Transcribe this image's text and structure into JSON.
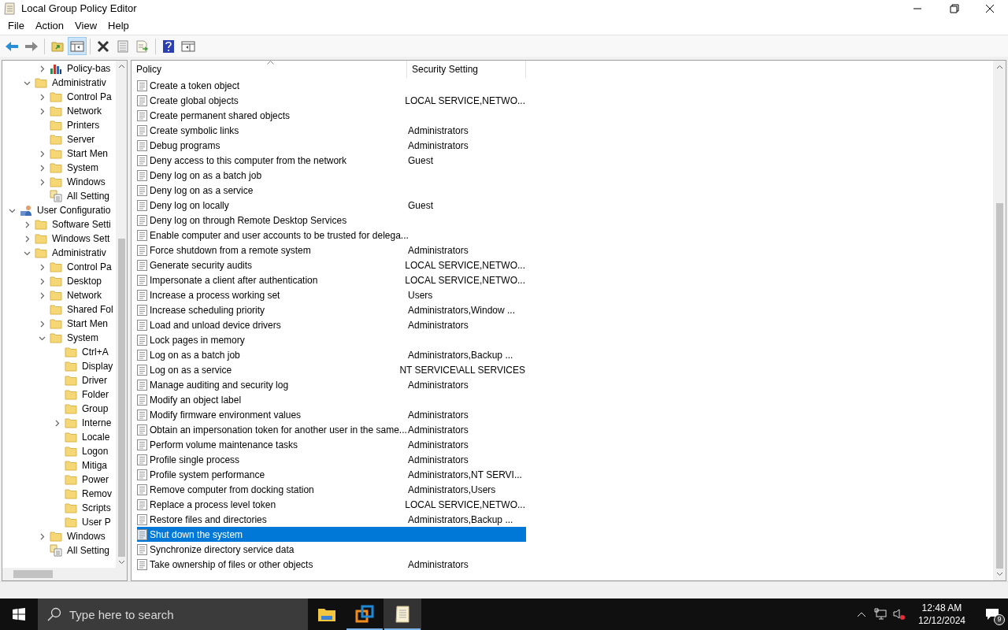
{
  "window": {
    "title": "Local Group Policy Editor"
  },
  "menu": [
    "File",
    "Action",
    "View",
    "Help"
  ],
  "toolbar": [
    [
      {
        "kind": "back",
        "pressed": false
      },
      {
        "kind": "forward",
        "pressed": false
      }
    ],
    [
      {
        "kind": "up",
        "pressed": false
      },
      {
        "kind": "tree",
        "pressed": true
      }
    ],
    [
      {
        "kind": "delete",
        "pressed": false
      },
      {
        "kind": "properties",
        "pressed": false
      },
      {
        "kind": "export",
        "pressed": false
      }
    ],
    [
      {
        "kind": "help",
        "pressed": false
      },
      {
        "kind": "pane",
        "pressed": false
      }
    ]
  ],
  "tree": [
    {
      "children": [
        {
          "children": [
            {
              "label": "Policy-bas",
              "kind": "chart",
              "expanded": false
            }
          ]
        },
        {
          "label": "Administrativ",
          "kind": "folder",
          "expanded": true,
          "children": [
            {
              "label": "Control Pa",
              "kind": "folder",
              "expanded": false
            },
            {
              "label": "Network",
              "kind": "folder",
              "expanded": false
            },
            {
              "label": "Printers",
              "kind": "folder"
            },
            {
              "label": "Server",
              "kind": "folder"
            },
            {
              "label": "Start Men",
              "kind": "folder",
              "expanded": false
            },
            {
              "label": "System",
              "kind": "folder",
              "expanded": false
            },
            {
              "label": "Windows",
              "kind": "folder",
              "expanded": false
            },
            {
              "label": "All Setting",
              "kind": "settings"
            }
          ]
        }
      ]
    },
    {
      "label": "User Configuratio",
      "kind": "user",
      "expanded": true,
      "children": [
        {
          "label": "Software Setti",
          "kind": "folder",
          "expanded": false
        },
        {
          "label": "Windows Sett",
          "kind": "folder",
          "expanded": false
        },
        {
          "label": "Administrativ",
          "kind": "folder",
          "expanded": true,
          "children": [
            {
              "label": "Control Pa",
              "kind": "folder",
              "expanded": false
            },
            {
              "label": "Desktop",
              "kind": "folder",
              "expanded": false
            },
            {
              "label": "Network",
              "kind": "folder",
              "expanded": false
            },
            {
              "label": "Shared Fol",
              "kind": "folder"
            },
            {
              "label": "Start Men",
              "kind": "folder",
              "expanded": false
            },
            {
              "label": "System",
              "kind": "folder",
              "expanded": true,
              "children": [
                {
                  "label": "Ctrl+A",
                  "kind": "folder"
                },
                {
                  "label": "Display",
                  "kind": "folder"
                },
                {
                  "label": "Driver",
                  "kind": "folder"
                },
                {
                  "label": "Folder",
                  "kind": "folder"
                },
                {
                  "label": "Group",
                  "kind": "folder"
                },
                {
                  "label": "Interne",
                  "kind": "folder",
                  "expanded": false
                },
                {
                  "label": "Locale",
                  "kind": "folder"
                },
                {
                  "label": "Logon",
                  "kind": "folder"
                },
                {
                  "label": "Mitiga",
                  "kind": "folder"
                },
                {
                  "label": "Power",
                  "kind": "folder"
                },
                {
                  "label": "Remov",
                  "kind": "folder"
                },
                {
                  "label": "Scripts",
                  "kind": "folder"
                },
                {
                  "label": "User P",
                  "kind": "folder"
                }
              ]
            },
            {
              "label": "Windows",
              "kind": "folder",
              "expanded": false
            },
            {
              "label": "All Setting",
              "kind": "settings"
            }
          ]
        }
      ]
    }
  ],
  "table": {
    "columns": [
      "Policy",
      "Security Setting"
    ],
    "rows": [
      {
        "policy": "Create a token object",
        "setting": "",
        "selected": false
      },
      {
        "policy": "Create global objects",
        "setting": "LOCAL SERVICE,NETWO...",
        "selected": false
      },
      {
        "policy": "Create permanent shared objects",
        "setting": "",
        "selected": false
      },
      {
        "policy": "Create symbolic links",
        "setting": "Administrators",
        "selected": false
      },
      {
        "policy": "Debug programs",
        "setting": "Administrators",
        "selected": false
      },
      {
        "policy": "Deny access to this computer from the network",
        "setting": "Guest",
        "selected": false
      },
      {
        "policy": "Deny log on as a batch job",
        "setting": "",
        "selected": false
      },
      {
        "policy": "Deny log on as a service",
        "setting": "",
        "selected": false
      },
      {
        "policy": "Deny log on locally",
        "setting": "Guest",
        "selected": false
      },
      {
        "policy": "Deny log on through Remote Desktop Services",
        "setting": "",
        "selected": false
      },
      {
        "policy": "Enable computer and user accounts to be trusted for delega...",
        "setting": "",
        "selected": false
      },
      {
        "policy": "Force shutdown from a remote system",
        "setting": "Administrators",
        "selected": false
      },
      {
        "policy": "Generate security audits",
        "setting": "LOCAL SERVICE,NETWO...",
        "selected": false
      },
      {
        "policy": "Impersonate a client after authentication",
        "setting": "LOCAL SERVICE,NETWO...",
        "selected": false
      },
      {
        "policy": "Increase a process working set",
        "setting": "Users",
        "selected": false
      },
      {
        "policy": "Increase scheduling priority",
        "setting": "Administrators,Window ...",
        "selected": false
      },
      {
        "policy": "Load and unload device drivers",
        "setting": "Administrators",
        "selected": false
      },
      {
        "policy": "Lock pages in memory",
        "setting": "",
        "selected": false
      },
      {
        "policy": "Log on as a batch job",
        "setting": "Administrators,Backup ...",
        "selected": false
      },
      {
        "policy": "Log on as a service",
        "setting": "NT SERVICE\\ALL SERVICES",
        "selected": false
      },
      {
        "policy": "Manage auditing and security log",
        "setting": "Administrators",
        "selected": false
      },
      {
        "policy": "Modify an object label",
        "setting": "",
        "selected": false
      },
      {
        "policy": "Modify firmware environment values",
        "setting": "Administrators",
        "selected": false
      },
      {
        "policy": "Obtain an impersonation token for another user in the same...",
        "setting": "Administrators",
        "selected": false
      },
      {
        "policy": "Perform volume maintenance tasks",
        "setting": "Administrators",
        "selected": false
      },
      {
        "policy": "Profile single process",
        "setting": "Administrators",
        "selected": false
      },
      {
        "policy": "Profile system performance",
        "setting": "Administrators,NT SERVI...",
        "selected": false
      },
      {
        "policy": "Remove computer from docking station",
        "setting": "Administrators,Users",
        "selected": false
      },
      {
        "policy": "Replace a process level token",
        "setting": "LOCAL SERVICE,NETWO...",
        "selected": false
      },
      {
        "policy": "Restore files and directories",
        "setting": "Administrators,Backup ...",
        "selected": false
      },
      {
        "policy": "Shut down the system",
        "setting": "",
        "selected": true
      },
      {
        "policy": "Synchronize directory service data",
        "setting": "",
        "selected": false
      },
      {
        "policy": "Take ownership of files or other objects",
        "setting": "Administrators",
        "selected": false
      }
    ]
  },
  "taskbar": {
    "search": {
      "placeholder": "Type here to search"
    },
    "apps": [
      {
        "kind": "explorer",
        "running": false,
        "selected": false
      },
      {
        "kind": "vm",
        "running": true,
        "selected": false
      },
      {
        "kind": "policy",
        "running": true,
        "selected": true
      }
    ],
    "time": "12:48 AM",
    "date": "12/12/2024",
    "notifications": "9"
  }
}
